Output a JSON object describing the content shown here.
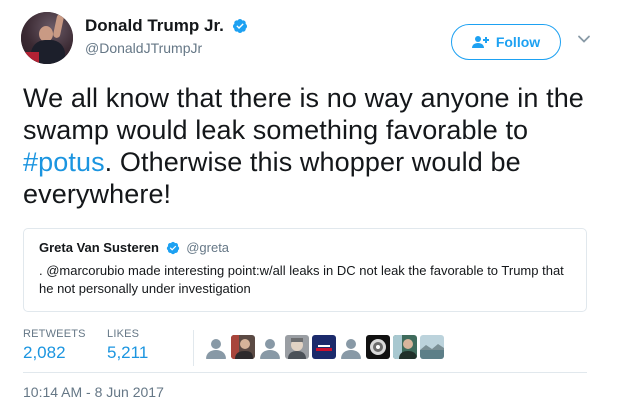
{
  "author": {
    "display_name": "Donald Trump Jr.",
    "handle": "@DonaldJTrumpJr",
    "verified_icon": "verified-badge-icon",
    "avatar_icon": "profile-photo"
  },
  "follow_button": {
    "label": "Follow",
    "icon": "add-user-icon"
  },
  "menu_icon": "chevron-down-icon",
  "tweet": {
    "text_before": "We all know that there is no way anyone in the swamp would leak something favorable to ",
    "hashtag": "#potus",
    "text_after": ". Otherwise this whopper would be everywhere!"
  },
  "quoted_tweet": {
    "name": "Greta Van Susteren",
    "handle": "@greta",
    "text": ". @marcorubio made interesting point:w/all leaks in DC not leak the favorable to Trump that he not personally under investigation"
  },
  "stats": {
    "retweets_label": "RETWEETS",
    "retweets_value": "2,082",
    "likes_label": "LIKES",
    "likes_value": "5,211"
  },
  "likers": [
    "default-avatar",
    "photo-avatar",
    "default-avatar",
    "photo-avatar",
    "flag-avatar",
    "default-avatar",
    "globe-avatar",
    "photo-avatar",
    "landscape-avatar"
  ],
  "timestamp": "10:14 AM - 8 Jun 2017",
  "colors": {
    "link_blue": "#1b95e0",
    "follow_blue": "#1da1f2",
    "muted_gray": "#657786",
    "border_gray": "#e1e8ed"
  }
}
